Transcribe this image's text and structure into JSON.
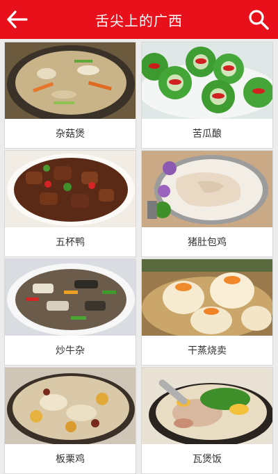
{
  "app": {
    "title": "舌尖上的广西",
    "accent": "#e8101a"
  },
  "toolbar": {
    "back_icon": "back-arrow-icon",
    "search_icon": "search-icon"
  },
  "dishes": [
    {
      "label": "杂菇煲"
    },
    {
      "label": "苦瓜酿"
    },
    {
      "label": "五杯鸭"
    },
    {
      "label": "猪肚包鸡"
    },
    {
      "label": "炒牛杂"
    },
    {
      "label": "干蒸烧卖"
    },
    {
      "label": "板栗鸡"
    },
    {
      "label": "瓦煲饭"
    }
  ]
}
